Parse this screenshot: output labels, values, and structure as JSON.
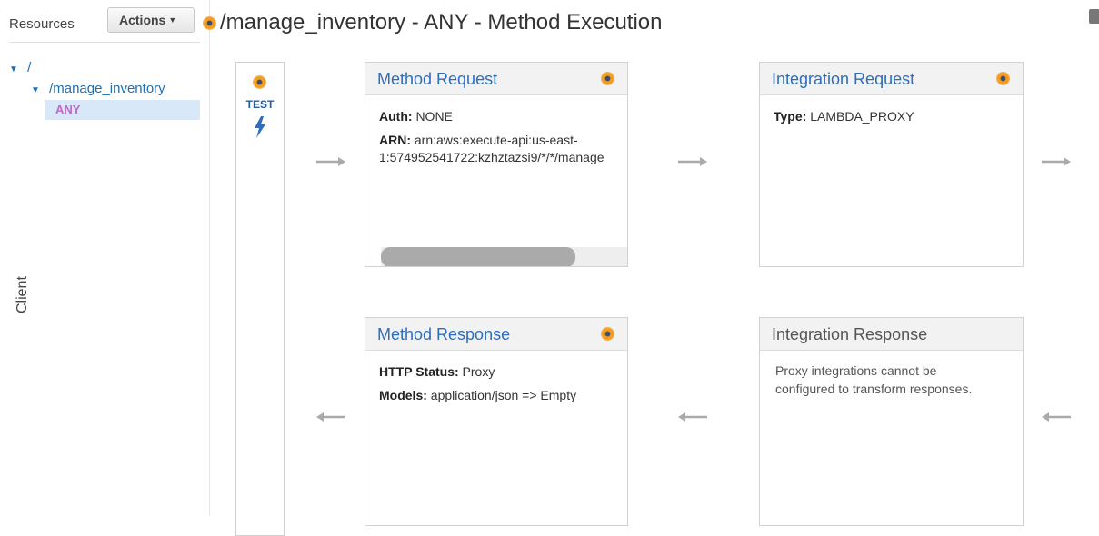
{
  "sidebar": {
    "resources_label": "Resources",
    "actions_label": "Actions",
    "tree": {
      "root": "/",
      "child": "/manage_inventory",
      "method": "ANY"
    }
  },
  "header": {
    "title": "/manage_inventory - ANY - Method Execution"
  },
  "client": {
    "test_label": "TEST",
    "label": "Client"
  },
  "cards": {
    "method_request": {
      "title": "Method Request",
      "auth_key": "Auth:",
      "auth_value": "NONE",
      "arn_key": "ARN:",
      "arn_line1": "arn:aws:execute-api:us-east-",
      "arn_line2": "1:574952541722:kzhztazsi9/*/*/manage"
    },
    "integration_request": {
      "title": "Integration Request",
      "type_key": "Type:",
      "type_value": "LAMBDA_PROXY"
    },
    "method_response": {
      "title": "Method Response",
      "status_key": "HTTP Status:",
      "status_value": "Proxy",
      "models_key": "Models:",
      "models_value": "application/json => Empty"
    },
    "integration_response": {
      "title": "Integration Response",
      "note_line1": "Proxy integrations cannot be",
      "note_line2": "configured to transform responses."
    }
  },
  "colors": {
    "link_blue": "#2e6ebe",
    "accent_orange": "#f59c1a",
    "selected_bg": "#d9e8f8",
    "method_purple": "#b86bc4"
  },
  "icons": {
    "status": "orange-dot-icon",
    "test": "lightning-bolt-icon",
    "flow": "arrow-icon"
  }
}
